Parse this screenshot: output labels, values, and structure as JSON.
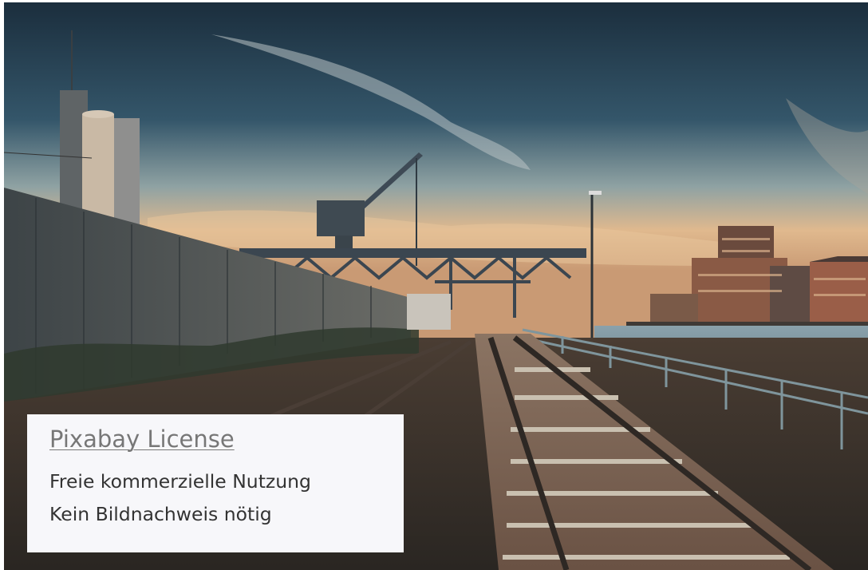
{
  "image": {
    "alt": "Freight harbor railway tracks leading past a crane, silos and brick warehouses under a dramatic evening sky"
  },
  "license": {
    "link_label": "Pixabay License",
    "lines": [
      "Freie kommerzielle Nutzung",
      "Kein Bildnachweis nötig"
    ]
  },
  "colors": {
    "card_background": "#f7f7fa",
    "link_text": "#777777",
    "body_text": "#333333"
  }
}
